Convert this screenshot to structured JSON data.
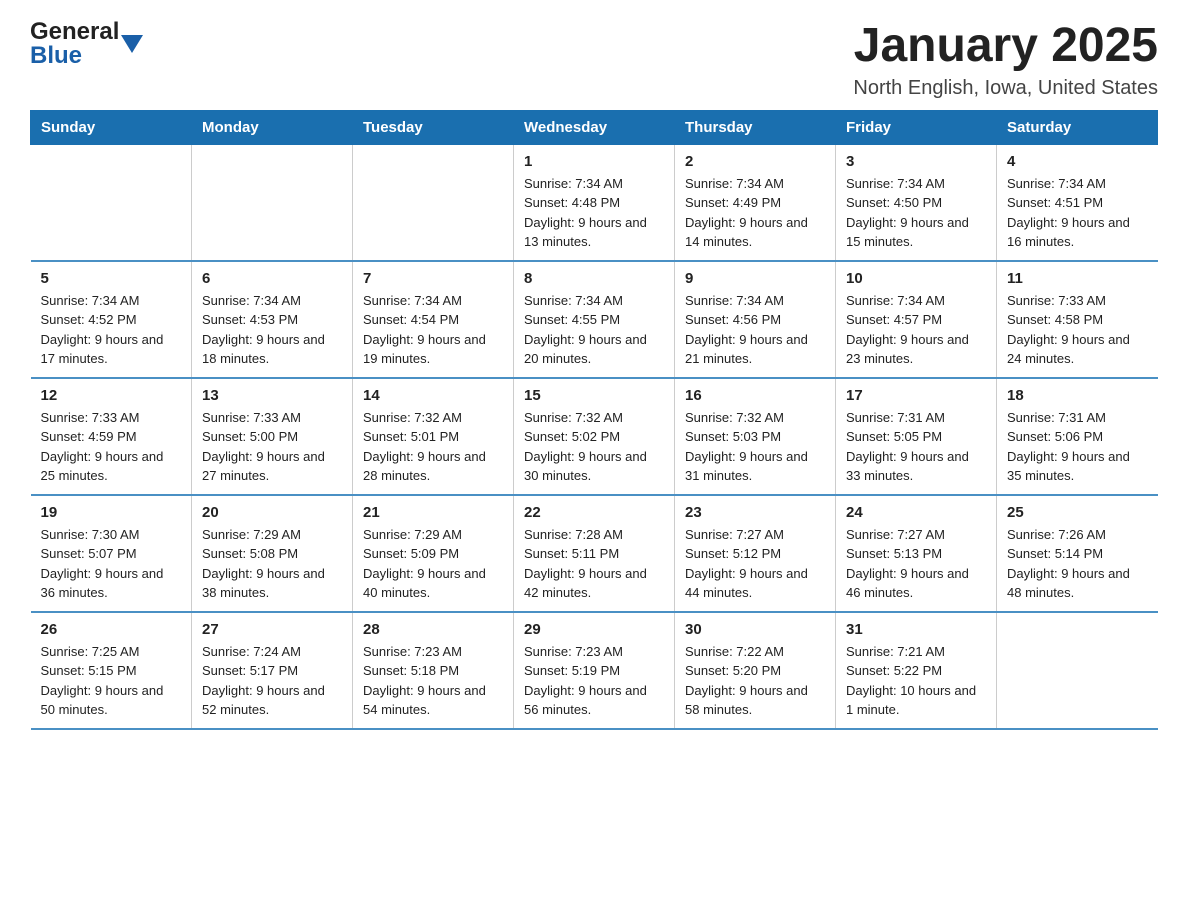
{
  "header": {
    "logo_general": "General",
    "logo_blue": "Blue",
    "month_title": "January 2025",
    "location": "North English, Iowa, United States"
  },
  "days_of_week": [
    "Sunday",
    "Monday",
    "Tuesday",
    "Wednesday",
    "Thursday",
    "Friday",
    "Saturday"
  ],
  "weeks": [
    [
      {
        "day": "",
        "info": ""
      },
      {
        "day": "",
        "info": ""
      },
      {
        "day": "",
        "info": ""
      },
      {
        "day": "1",
        "info": "Sunrise: 7:34 AM\nSunset: 4:48 PM\nDaylight: 9 hours and 13 minutes."
      },
      {
        "day": "2",
        "info": "Sunrise: 7:34 AM\nSunset: 4:49 PM\nDaylight: 9 hours and 14 minutes."
      },
      {
        "day": "3",
        "info": "Sunrise: 7:34 AM\nSunset: 4:50 PM\nDaylight: 9 hours and 15 minutes."
      },
      {
        "day": "4",
        "info": "Sunrise: 7:34 AM\nSunset: 4:51 PM\nDaylight: 9 hours and 16 minutes."
      }
    ],
    [
      {
        "day": "5",
        "info": "Sunrise: 7:34 AM\nSunset: 4:52 PM\nDaylight: 9 hours and 17 minutes."
      },
      {
        "day": "6",
        "info": "Sunrise: 7:34 AM\nSunset: 4:53 PM\nDaylight: 9 hours and 18 minutes."
      },
      {
        "day": "7",
        "info": "Sunrise: 7:34 AM\nSunset: 4:54 PM\nDaylight: 9 hours and 19 minutes."
      },
      {
        "day": "8",
        "info": "Sunrise: 7:34 AM\nSunset: 4:55 PM\nDaylight: 9 hours and 20 minutes."
      },
      {
        "day": "9",
        "info": "Sunrise: 7:34 AM\nSunset: 4:56 PM\nDaylight: 9 hours and 21 minutes."
      },
      {
        "day": "10",
        "info": "Sunrise: 7:34 AM\nSunset: 4:57 PM\nDaylight: 9 hours and 23 minutes."
      },
      {
        "day": "11",
        "info": "Sunrise: 7:33 AM\nSunset: 4:58 PM\nDaylight: 9 hours and 24 minutes."
      }
    ],
    [
      {
        "day": "12",
        "info": "Sunrise: 7:33 AM\nSunset: 4:59 PM\nDaylight: 9 hours and 25 minutes."
      },
      {
        "day": "13",
        "info": "Sunrise: 7:33 AM\nSunset: 5:00 PM\nDaylight: 9 hours and 27 minutes."
      },
      {
        "day": "14",
        "info": "Sunrise: 7:32 AM\nSunset: 5:01 PM\nDaylight: 9 hours and 28 minutes."
      },
      {
        "day": "15",
        "info": "Sunrise: 7:32 AM\nSunset: 5:02 PM\nDaylight: 9 hours and 30 minutes."
      },
      {
        "day": "16",
        "info": "Sunrise: 7:32 AM\nSunset: 5:03 PM\nDaylight: 9 hours and 31 minutes."
      },
      {
        "day": "17",
        "info": "Sunrise: 7:31 AM\nSunset: 5:05 PM\nDaylight: 9 hours and 33 minutes."
      },
      {
        "day": "18",
        "info": "Sunrise: 7:31 AM\nSunset: 5:06 PM\nDaylight: 9 hours and 35 minutes."
      }
    ],
    [
      {
        "day": "19",
        "info": "Sunrise: 7:30 AM\nSunset: 5:07 PM\nDaylight: 9 hours and 36 minutes."
      },
      {
        "day": "20",
        "info": "Sunrise: 7:29 AM\nSunset: 5:08 PM\nDaylight: 9 hours and 38 minutes."
      },
      {
        "day": "21",
        "info": "Sunrise: 7:29 AM\nSunset: 5:09 PM\nDaylight: 9 hours and 40 minutes."
      },
      {
        "day": "22",
        "info": "Sunrise: 7:28 AM\nSunset: 5:11 PM\nDaylight: 9 hours and 42 minutes."
      },
      {
        "day": "23",
        "info": "Sunrise: 7:27 AM\nSunset: 5:12 PM\nDaylight: 9 hours and 44 minutes."
      },
      {
        "day": "24",
        "info": "Sunrise: 7:27 AM\nSunset: 5:13 PM\nDaylight: 9 hours and 46 minutes."
      },
      {
        "day": "25",
        "info": "Sunrise: 7:26 AM\nSunset: 5:14 PM\nDaylight: 9 hours and 48 minutes."
      }
    ],
    [
      {
        "day": "26",
        "info": "Sunrise: 7:25 AM\nSunset: 5:15 PM\nDaylight: 9 hours and 50 minutes."
      },
      {
        "day": "27",
        "info": "Sunrise: 7:24 AM\nSunset: 5:17 PM\nDaylight: 9 hours and 52 minutes."
      },
      {
        "day": "28",
        "info": "Sunrise: 7:23 AM\nSunset: 5:18 PM\nDaylight: 9 hours and 54 minutes."
      },
      {
        "day": "29",
        "info": "Sunrise: 7:23 AM\nSunset: 5:19 PM\nDaylight: 9 hours and 56 minutes."
      },
      {
        "day": "30",
        "info": "Sunrise: 7:22 AM\nSunset: 5:20 PM\nDaylight: 9 hours and 58 minutes."
      },
      {
        "day": "31",
        "info": "Sunrise: 7:21 AM\nSunset: 5:22 PM\nDaylight: 10 hours and 1 minute."
      },
      {
        "day": "",
        "info": ""
      }
    ]
  ]
}
